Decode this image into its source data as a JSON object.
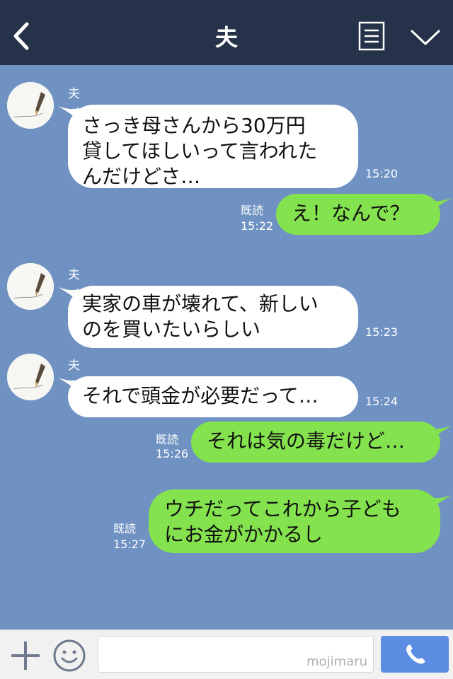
{
  "header": {
    "title": "夫",
    "icons": {
      "back": "chevron-left-icon",
      "menu": "list-icon",
      "more": "chevron-down-icon"
    },
    "background": "#263249"
  },
  "chat": {
    "background": "#7092c2",
    "messages": [
      {
        "direction": "in",
        "sender": "夫",
        "text": "さっき母さんから30万円\n貸してほしいって言われた\nんだけどさ…",
        "time": "15:20"
      },
      {
        "direction": "out",
        "read": "既読",
        "text": "え！なんで？",
        "time": "15:22"
      },
      {
        "direction": "in",
        "sender": "夫",
        "text": "実家の車が壊れて、新しい\nのを買いたいらしい",
        "time": "15:23"
      },
      {
        "direction": "in",
        "sender": "夫",
        "text": "それで頭金が必要だって…",
        "time": "15:24"
      },
      {
        "direction": "out",
        "read": "既読",
        "text": "それは気の毒だけど…",
        "time": "15:26"
      },
      {
        "direction": "out",
        "read": "既読",
        "text": "ウチだってこれから子ども\nにお金がかかるし",
        "time": "15:27"
      }
    ],
    "colors": {
      "incoming_bubble": "#ffffff",
      "outgoing_bubble": "#84e24e"
    }
  },
  "footer": {
    "input_value": "",
    "watermark": "mojimaru",
    "icons": {
      "plus": "plus-icon",
      "emoji": "smiley-icon",
      "call": "phone-icon"
    },
    "call_button_color": "#5b8de3"
  }
}
